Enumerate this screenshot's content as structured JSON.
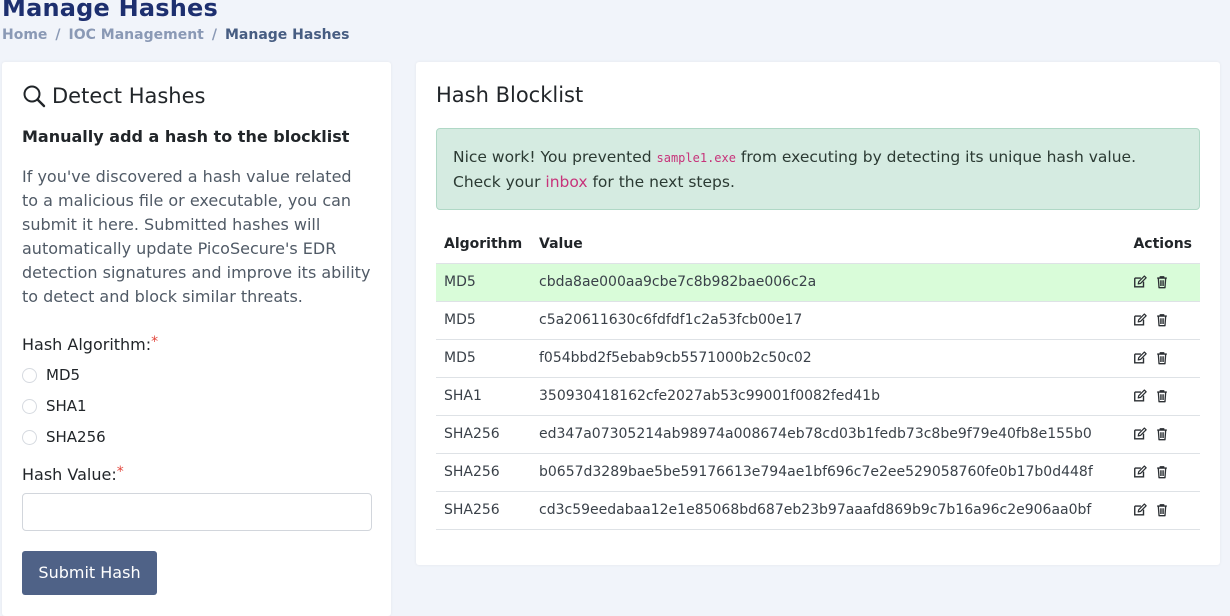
{
  "page": {
    "title": "Manage Hashes",
    "breadcrumb": [
      "Home",
      "IOC Management",
      "Manage Hashes"
    ]
  },
  "detect": {
    "title": "Detect Hashes",
    "subhead": "Manually add a hash to the blocklist",
    "description": "If you've discovered a hash value related to a malicious file or executable, you can submit it here. Submitted hashes will automatically update PicoSecure's EDR detection signatures and improve its ability to detect and block similar threats.",
    "algorithm_label": "Hash Algorithm:",
    "required_mark": "*",
    "algorithms": [
      "MD5",
      "SHA1",
      "SHA256"
    ],
    "hash_value_label": "Hash Value:",
    "hash_value": "",
    "submit_label": "Submit Hash"
  },
  "blocklist": {
    "title": "Hash Blocklist",
    "alert": {
      "prefix": "Nice work! You prevented ",
      "filename": "sample1.exe",
      "middle": " from executing by detecting its unique hash value. Check your ",
      "link": "inbox",
      "suffix": " for the next steps."
    },
    "columns": [
      "Algorithm",
      "Value",
      "Actions"
    ],
    "rows": [
      {
        "algorithm": "MD5",
        "value": "cbda8ae000aa9cbe7c8b982bae006c2a",
        "highlighted": true
      },
      {
        "algorithm": "MD5",
        "value": "c5a20611630c6fdfdf1c2a53fcb00e17",
        "highlighted": false
      },
      {
        "algorithm": "MD5",
        "value": "f054bbd2f5ebab9cb5571000b2c50c02",
        "highlighted": false
      },
      {
        "algorithm": "SHA1",
        "value": "350930418162cfe2027ab53c99001f0082fed41b",
        "highlighted": false
      },
      {
        "algorithm": "SHA256",
        "value": "ed347a07305214ab98974a008674eb78cd03b1fedb73c8be9f79e40fb8e155b0",
        "highlighted": false
      },
      {
        "algorithm": "SHA256",
        "value": "b0657d3289bae5be59176613e794ae1bf696c7e2ee529058760fe0b17b0d448f",
        "highlighted": false
      },
      {
        "algorithm": "SHA256",
        "value": "cd3c59eedabaa12e1e85068bd687eb23b97aaafd869b9c7b16a96c2e906aa0bf",
        "highlighted": false
      }
    ],
    "row_icons": [
      "edit-icon",
      "trash-icon"
    ]
  },
  "colors": {
    "title": "#1d2f6f",
    "button": "#4f6287",
    "alert_bg": "#d5ebe1",
    "highlight_row": "#d9fcd9",
    "accent_pink": "#c7337a"
  }
}
